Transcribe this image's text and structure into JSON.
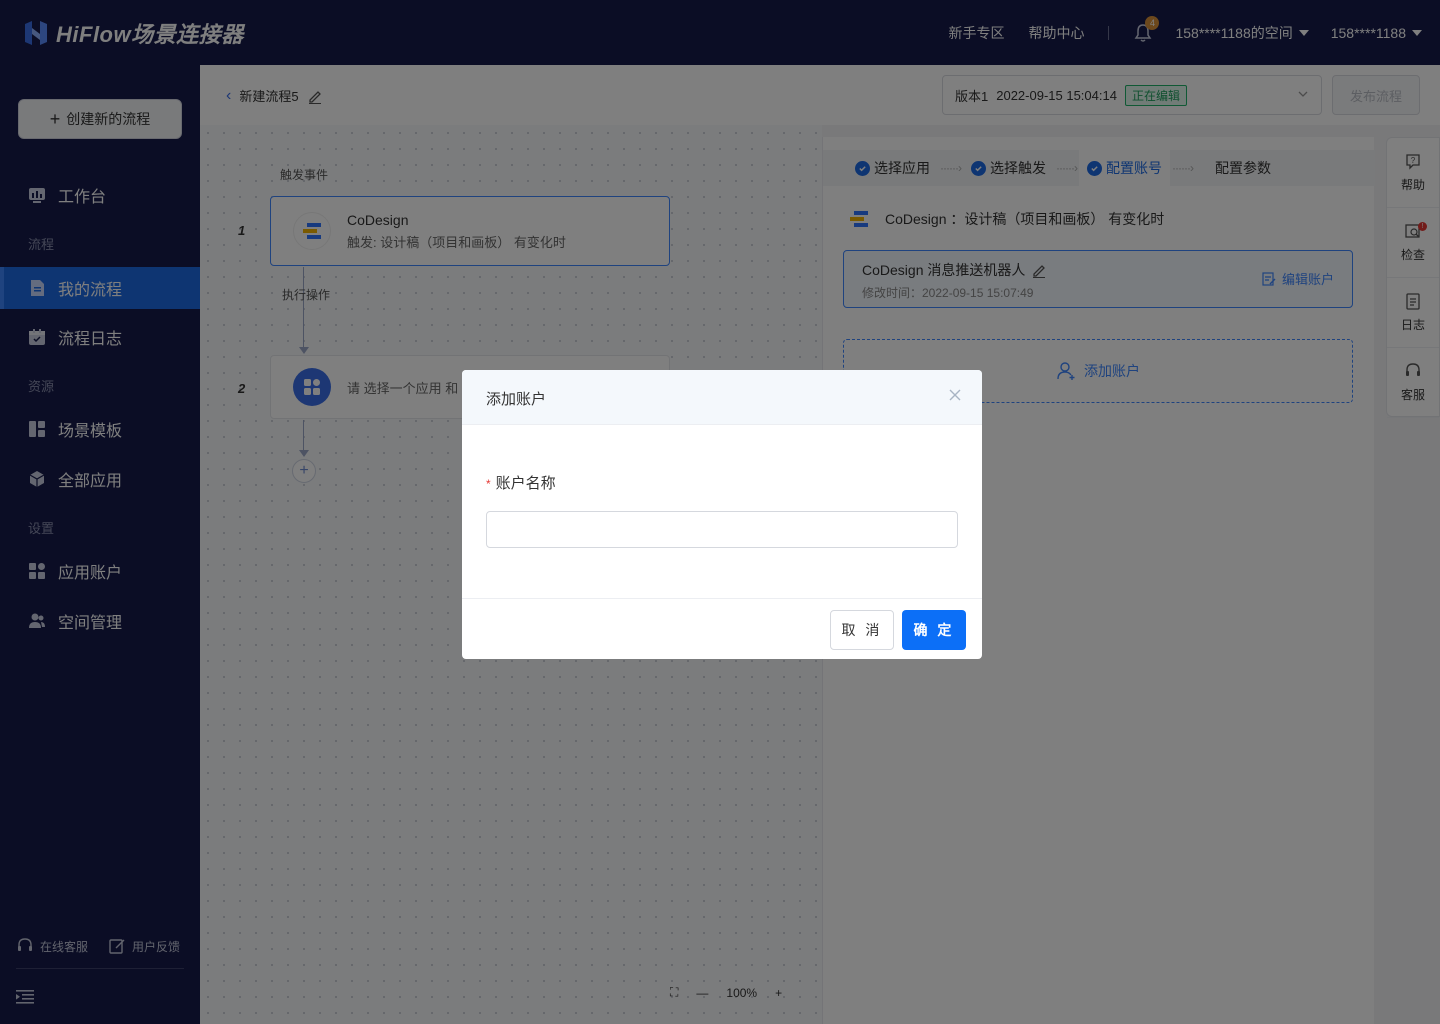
{
  "header": {
    "brand": "HiFlow场景连接器",
    "links": [
      "新手专区",
      "帮助中心"
    ],
    "notification_count": "4",
    "space_dropdown": "158****1188的空间",
    "user_dropdown": "158****1188"
  },
  "sidebar": {
    "create_button": "创建新的流程",
    "groups": {
      "flow": "流程",
      "resource": "资源",
      "settings": "设置"
    },
    "items": [
      "工作台",
      "我的流程",
      "流程日志",
      "场景模板",
      "全部应用",
      "应用账户",
      "空间管理"
    ],
    "active_item": "我的流程",
    "bottom": {
      "online_service": "在线客服",
      "feedback": "用户反馈"
    }
  },
  "editor": {
    "flow_name": "新建流程5",
    "version": "版本1",
    "version_time": "2022-09-15 15:04:14",
    "version_status": "正在编辑",
    "publish_button": "发布流程"
  },
  "canvas": {
    "trigger_label": "触发事件",
    "action_label": "执行操作",
    "step1_no": "1",
    "step2_no": "2",
    "trigger_app": "CoDesign",
    "trigger_desc": "触发: 设计稿（项目和画板） 有变化时",
    "action_prompt": "请 选择一个应用 和",
    "zoom": "100%"
  },
  "panel": {
    "steps": [
      "选择应用",
      "选择触发",
      "配置账号",
      "配置参数"
    ],
    "active_step": "配置账号",
    "app_summary": "CoDesign ：设计稿（项目和画板） 有变化时",
    "account_name": "CoDesign 消息推送机器人",
    "account_time": "修改时间：2022-09-15 15:07:49",
    "edit_account": "编辑账户",
    "add_account": "添加账户"
  },
  "right_toolbar": {
    "help": "帮助",
    "check": "检查",
    "log": "日志",
    "service": "客服",
    "check_badge": "!"
  },
  "modal": {
    "title": "添加账户",
    "field_label": "账户名称",
    "field_value": "",
    "cancel": "取 消",
    "confirm": "确 定"
  },
  "colors": {
    "nav_bg": "#161b4a",
    "primary": "#0c6ff7",
    "active_nav": "#1d6ae5",
    "editing_tag": "#21a05f"
  }
}
